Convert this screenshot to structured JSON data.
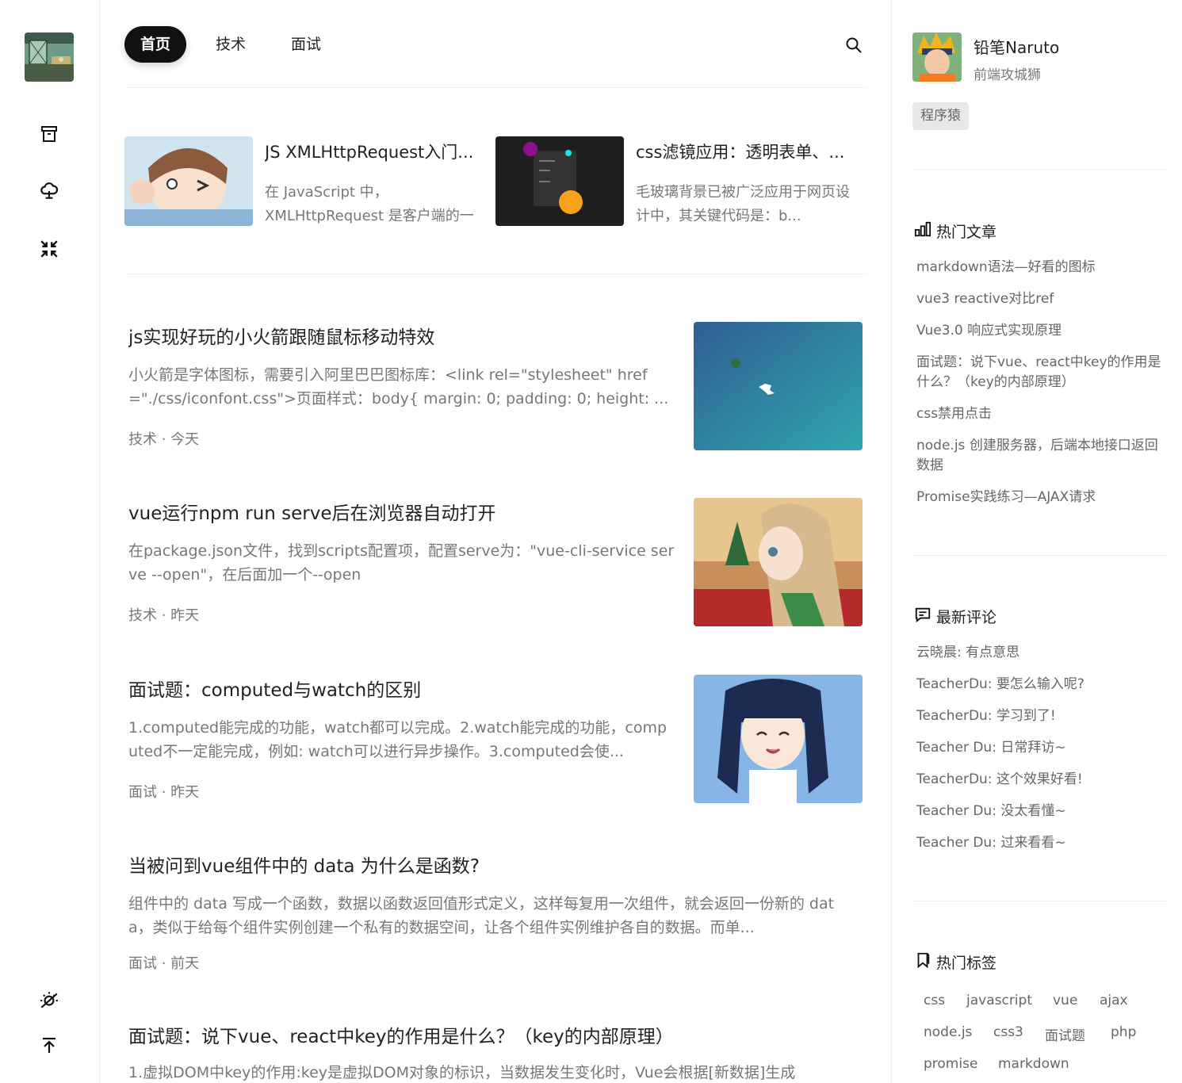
{
  "rail": {
    "icons": [
      "archive-icon",
      "cloud-upload-icon",
      "collapse-arrows-icon",
      "theme-toggle-icon",
      "back-to-top-icon"
    ]
  },
  "nav": {
    "tabs": [
      {
        "label": "首页",
        "active": true
      },
      {
        "label": "技术",
        "active": false
      },
      {
        "label": "面试",
        "active": false
      }
    ]
  },
  "featured": [
    {
      "title": "JS XMLHttpRequest入门...",
      "desc": "在 JavaScript 中，XMLHttpRequest 是客户端的一个 A..."
    },
    {
      "title": "css滤镜应用：透明表单、...",
      "desc": "毛玻璃背景已被广泛应用于网页设计中，其关键代码是：b..."
    }
  ],
  "posts": [
    {
      "title": "js实现好玩的小火箭跟随鼠标移动特效",
      "desc": "小火箭是字体图标，需要引入阿里巴巴图标库：<link rel=\"stylesheet\" href=\"./css/iconfont.css\">页面样式：body{ margin: 0; padding: 0; height: ...",
      "meta": "技术 · 今天"
    },
    {
      "title": "vue运行npm run serve后在浏览器自动打开",
      "desc": "在package.json文件，找到scripts配置项，配置serve为：\"vue-cli-service serve --open\"，在后面加一个--open",
      "meta": "技术 · 昨天"
    },
    {
      "title": "面试题：computed与watch的区别",
      "desc": "1.computed能完成的功能，watch都可以完成。2.watch能完成的功能，computed不一定能完成，例如: watch可以进行异步操作。3.computed会使...",
      "meta": "面试 · 昨天"
    },
    {
      "title": "当被问到vue组件中的 data 为什么是函数?",
      "desc": "组件中的 data 写成一个函数，数据以函数返回值形式定义，这样每复用一次组件，就会返回一份新的 data，类似于给每个组件实例创建一个私有的数据空间，让各个组件实例维护各自的数据。而单...",
      "meta": "面试 · 前天"
    },
    {
      "title": "面试题：说下vue、react中key的作用是什么？（key的内部原理）",
      "desc": "1.虚拟DOM中key的作用:key是虚拟DOM对象的标识，当数据发生变化时，Vue会根据[新数据]生成",
      "meta": ""
    }
  ],
  "profile": {
    "name": "铅笔Naruto",
    "role": "前端攻城狮",
    "badge": "程序猿"
  },
  "hot": {
    "title": "热门文章",
    "items": [
      "markdown语法—好看的图标",
      "vue3 reactive对比ref",
      "Vue3.0 响应式实现原理",
      "面试题：说下vue、react中key的作用是什么？（key的内部原理）",
      "css禁用点击",
      "node.js 创建服务器，后端本地接口返回数据",
      "Promise实践练习—AJAX请求"
    ]
  },
  "comments": {
    "title": "最新评论",
    "items": [
      "云晓晨: 有点意思",
      "TeacherDu: 要怎么输入呢?",
      "TeacherDu: 学习到了!",
      "Teacher Du: 日常拜访~",
      "TeacherDu: 这个效果好看!",
      "Teacher Du: 没太看懂~",
      "Teacher Du: 过来看看~"
    ]
  },
  "tags": {
    "title": "热门标签",
    "items": [
      "css",
      "javascript",
      "vue",
      "ajax",
      "node.js",
      "css3",
      "面试题",
      "php",
      "promise",
      "markdown"
    ]
  }
}
